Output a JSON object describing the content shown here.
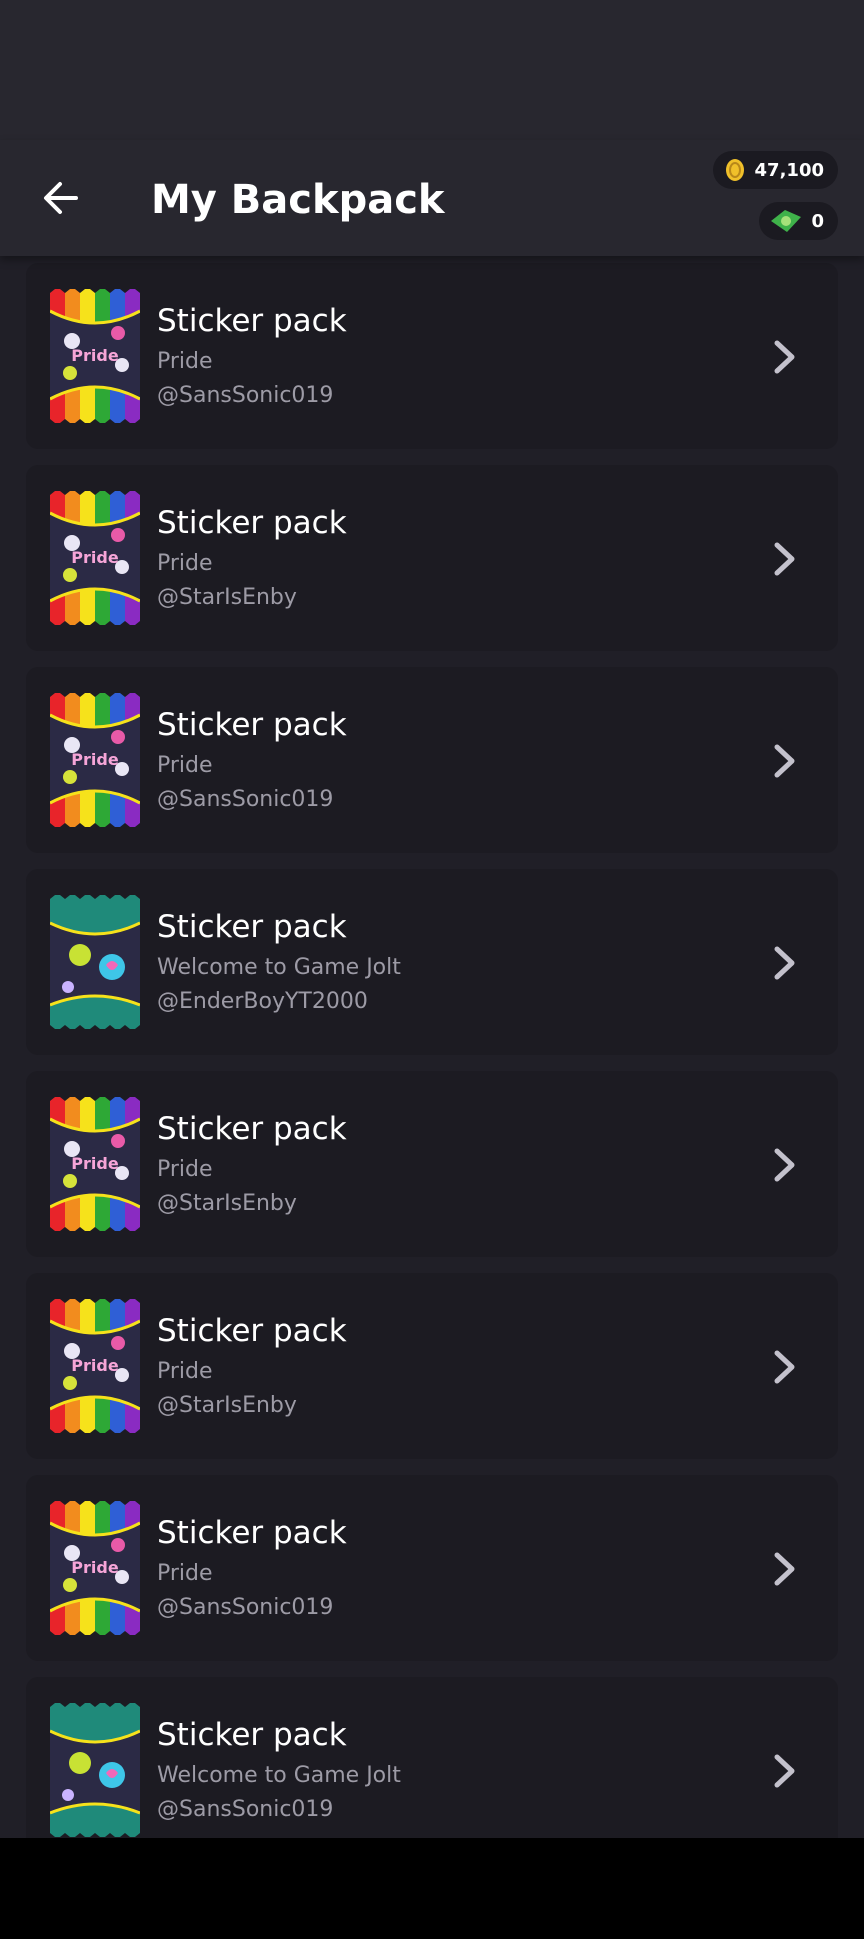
{
  "header": {
    "title": "My Backpack",
    "back_icon": "arrow-left-icon"
  },
  "wallet": {
    "coins": {
      "icon": "coin-icon",
      "amount": "47,100"
    },
    "joltbux": {
      "icon": "joltbux-icon",
      "amount": "0"
    }
  },
  "items": [
    {
      "name": "Sticker pack",
      "pack": "Pride",
      "owner": "@SansSonic019",
      "art": "pride"
    },
    {
      "name": "Sticker pack",
      "pack": "Pride",
      "owner": "@StarIsEnby",
      "art": "pride"
    },
    {
      "name": "Sticker pack",
      "pack": "Pride",
      "owner": "@SansSonic019",
      "art": "pride"
    },
    {
      "name": "Sticker pack",
      "pack": "Welcome to Game Jolt",
      "owner": "@EnderBoyYT2000",
      "art": "welcome"
    },
    {
      "name": "Sticker pack",
      "pack": "Pride",
      "owner": "@StarIsEnby",
      "art": "pride"
    },
    {
      "name": "Sticker pack",
      "pack": "Pride",
      "owner": "@StarIsEnby",
      "art": "pride"
    },
    {
      "name": "Sticker pack",
      "pack": "Pride",
      "owner": "@SansSonic019",
      "art": "pride"
    },
    {
      "name": "Sticker pack",
      "pack": "Welcome to Game Jolt",
      "owner": "@SansSonic019",
      "art": "welcome"
    }
  ],
  "colors": {
    "background": "#201f27",
    "header": "#28272f",
    "card": "#1c1b22",
    "secondary_text": "#9d9ba6",
    "coin": "#f0c02a",
    "joltbux": "#3fb24a"
  }
}
